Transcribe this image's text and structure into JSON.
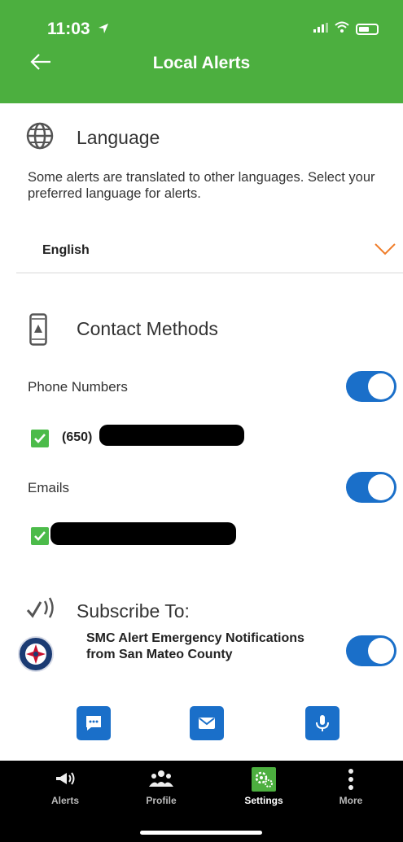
{
  "status": {
    "time": "11:03"
  },
  "header": {
    "title": "Local Alerts"
  },
  "language": {
    "title": "Language",
    "description": "Some alerts are translated to other languages. Select  your preferred language for alerts.",
    "selected": "English"
  },
  "contact": {
    "title": "Contact Methods",
    "phones_label": "Phone Numbers",
    "phone_prefix": "(650)",
    "emails_label": "Emails"
  },
  "subscribe": {
    "title": "Subscribe To:",
    "item_line1": "SMC Alert Emergency Notifications",
    "item_line2": "from San Mateo County"
  },
  "tabs": [
    {
      "label": "Alerts",
      "icon": "megaphone-icon"
    },
    {
      "label": "Profile",
      "icon": "people-icon"
    },
    {
      "label": "Settings",
      "icon": "gears-icon"
    },
    {
      "label": "More",
      "icon": "dots-vertical-icon"
    }
  ],
  "colors": {
    "header": "#4caf3f",
    "accent": "#1a6fc9",
    "check": "#4cbb4a",
    "chevron": "#f07d2a"
  }
}
